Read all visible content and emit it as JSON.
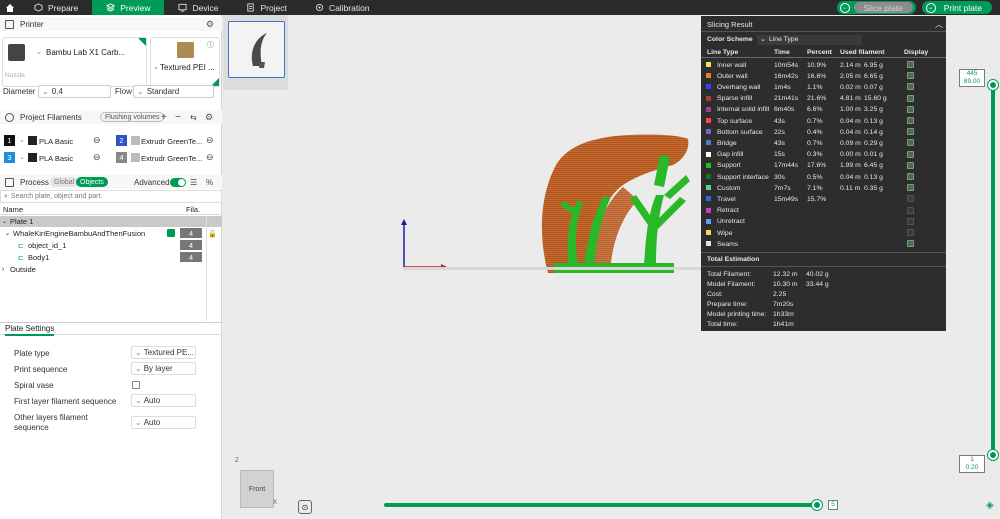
{
  "tabs": {
    "prepare": "Prepare",
    "preview": "Preview",
    "device": "Device",
    "project": "Project",
    "calibration": "Calibration"
  },
  "toolbar": {
    "slice_plate": "Slice plate",
    "print_plate": "Print plate"
  },
  "printer": {
    "section_label": "Printer",
    "name": "Bambu Lab X1 Carb...",
    "plate": "Textured PEI ...",
    "nozzle_label": "Nozzle",
    "diameter_label": "Diameter",
    "diameter_value": "0.4",
    "flow_label": "Flow",
    "flow_value": "Standard"
  },
  "filaments": {
    "section_label": "Project Filaments",
    "flushing_label": "Flushing volumes",
    "items": [
      {
        "num": "1",
        "name": "PLA Basic",
        "color": "#111111"
      },
      {
        "num": "2",
        "name": "Extrudr GreenTe...",
        "color": "#2a55c8"
      },
      {
        "num": "3",
        "name": "PLA Basic",
        "color": "#1e8fd6"
      },
      {
        "num": "4",
        "name": "Extrudr GreenTe...",
        "color": "#888888"
      }
    ]
  },
  "process": {
    "section_label": "Process",
    "global_label": "Global",
    "objects_label": "Objects",
    "advanced_label": "Advanced",
    "search_placeholder": "Search plate, object and part.",
    "col_name": "Name",
    "col_fila": "Fila.",
    "tree": {
      "plate": "Plate 1",
      "object": "WhaleKiriEngineBambuAndThenFusion",
      "object_fila": "4",
      "part1": "object_id_1",
      "part1_fila": "4",
      "part2": "Body1",
      "part2_fila": "4",
      "outside": "Outside"
    }
  },
  "plate_settings": {
    "title": "Plate Settings",
    "rows": [
      {
        "label": "Plate type",
        "value": "Textured PE..."
      },
      {
        "label": "Print sequence",
        "value": "By layer"
      },
      {
        "label": "Spiral vase",
        "value": ""
      },
      {
        "label": "First layer filament sequence",
        "value": "Auto"
      },
      {
        "label": "Other layers filament sequence",
        "value": "Auto"
      }
    ]
  },
  "viewport": {
    "thumb_num": "1",
    "view_cube_label": "Front",
    "axis_z": "Z",
    "axis_x": "X",
    "layer_top": "445",
    "layer_top_height": "89.00",
    "layer_bottom": "1",
    "layer_bottom_height": "0.20",
    "move_value": "5"
  },
  "slicing_result": {
    "title": "Slicing Result",
    "color_scheme_label": "Color Scheme",
    "color_scheme_value": "Line Type",
    "headers": {
      "line_type": "Line Type",
      "time": "Time",
      "percent": "Percent",
      "used": "Used filament",
      "display": "Display"
    },
    "rows": [
      {
        "name": "Inner wall",
        "color": "#f4e34a",
        "time": "10m54s",
        "percent": "10.9%",
        "m": "2.14 m",
        "g": "6.95 g",
        "display": true
      },
      {
        "name": "Outer wall",
        "color": "#f07a2a",
        "time": "16m42s",
        "percent": "16.6%",
        "m": "2.05 m",
        "g": "6.65 g",
        "display": true
      },
      {
        "name": "Overhang wall",
        "color": "#3a3aff",
        "time": "1m4s",
        "percent": "1.1%",
        "m": "0.02 m",
        "g": "0.07 g",
        "display": true
      },
      {
        "name": "Sparse infill",
        "color": "#b33b3b",
        "time": "21m41s",
        "percent": "21.6%",
        "m": "4.81 m",
        "g": "15.60 g",
        "display": true
      },
      {
        "name": "Internal solid infill",
        "color": "#a83a9a",
        "time": "6m40s",
        "percent": "6.6%",
        "m": "1.00 m",
        "g": "3.25 g",
        "display": true
      },
      {
        "name": "Top surface",
        "color": "#ff4545",
        "time": "43s",
        "percent": "0.7%",
        "m": "0.04 m",
        "g": "0.13 g",
        "display": true
      },
      {
        "name": "Bottom surface",
        "color": "#6c6cc8",
        "time": "22s",
        "percent": "0.4%",
        "m": "0.04 m",
        "g": "0.14 g",
        "display": true
      },
      {
        "name": "Bridge",
        "color": "#4a7ad6",
        "time": "43s",
        "percent": "0.7%",
        "m": "0.09 m",
        "g": "0.29 g",
        "display": true
      },
      {
        "name": "Gap infill",
        "color": "#ffffff",
        "time": "15s",
        "percent": "0.3%",
        "m": "0.00 m",
        "g": "0.01 g",
        "display": true
      },
      {
        "name": "Support",
        "color": "#20c020",
        "time": "17m44s",
        "percent": "17.6%",
        "m": "1.99 m",
        "g": "6.45 g",
        "display": true
      },
      {
        "name": "Support interface",
        "color": "#127a12",
        "time": "30s",
        "percent": "0.5%",
        "m": "0.04 m",
        "g": "0.13 g",
        "display": true
      },
      {
        "name": "Custom",
        "color": "#5ad28a",
        "time": "7m7s",
        "percent": "7.1%",
        "m": "0.11 m",
        "g": "0.35 g",
        "display": true
      },
      {
        "name": "Travel",
        "color": "#2a6ad6",
        "time": "15m49s",
        "percent": "15.7%",
        "m": "",
        "g": "",
        "display": false
      },
      {
        "name": "Retract",
        "color": "#c83ac8",
        "time": "",
        "percent": "",
        "m": "",
        "g": "",
        "display": false
      },
      {
        "name": "Unretract",
        "color": "#5aa0ff",
        "time": "",
        "percent": "",
        "m": "",
        "g": "",
        "display": false
      },
      {
        "name": "Wipe",
        "color": "#ffd84a",
        "time": "",
        "percent": "",
        "m": "",
        "g": "",
        "display": false
      },
      {
        "name": "Seams",
        "color": "#e6e6e6",
        "time": "",
        "percent": "",
        "m": "",
        "g": "",
        "display": true
      }
    ],
    "estimation_title": "Total Estimation",
    "estimation": [
      {
        "label": "Total Filament:",
        "v1": "12.32 m",
        "v2": "40.02 g"
      },
      {
        "label": "Model Filament:",
        "v1": "10.30 m",
        "v2": "33.44 g"
      },
      {
        "label": "Cost:",
        "v1": "2.25",
        "v2": ""
      },
      {
        "label": "Prepare time:",
        "v1": "7m20s",
        "v2": ""
      },
      {
        "label": "Model printing time:",
        "v1": "1h33m",
        "v2": ""
      },
      {
        "label": "Total time:",
        "v1": "1h41m",
        "v2": ""
      }
    ]
  }
}
